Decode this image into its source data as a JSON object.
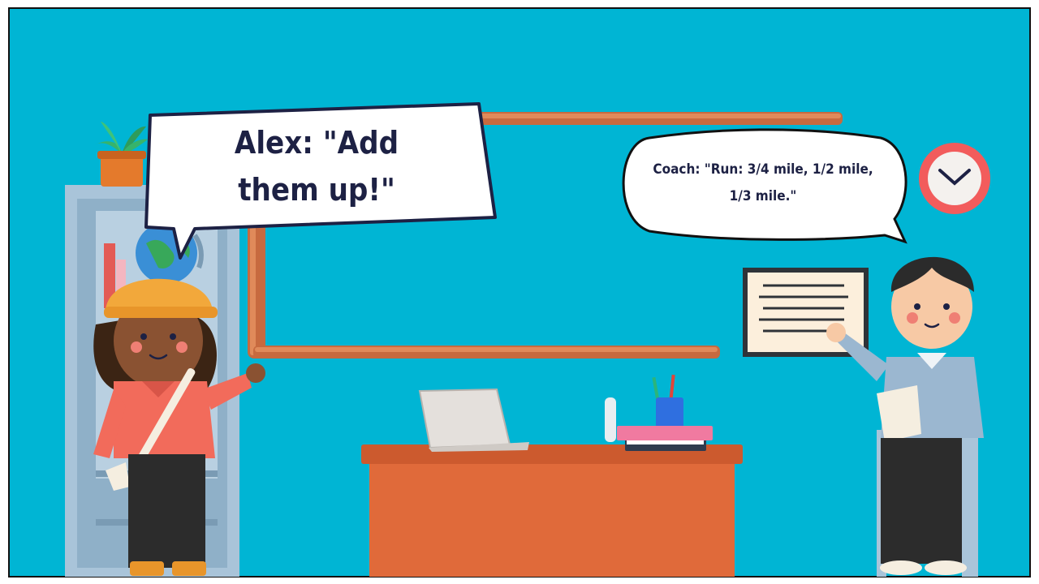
{
  "scene": {
    "colors": {
      "background": "#00b5d4",
      "frame": "#111111",
      "board_frame": "#c76a3f",
      "desk": "#e06a3a",
      "desk_top": "#cc5a2e",
      "bubble_fill": "#ffffff",
      "bubble_outline": "#1d2144",
      "clock_ring": "#f25c5c",
      "alex_shirt": "#f26b5b",
      "alex_hat": "#f2a83b",
      "coach_shirt": "#9bb7d0"
    },
    "icons": [
      "plant-icon",
      "globe-icon",
      "clock-icon",
      "laptop-icon",
      "pencil-cup-icon",
      "books-icon"
    ]
  },
  "dialogue": {
    "alex": "Alex: \"Add them up!\"",
    "coach": "Coach: \"Run: 3/4 mile, 1/2 mile, 1/3 mile.\""
  }
}
